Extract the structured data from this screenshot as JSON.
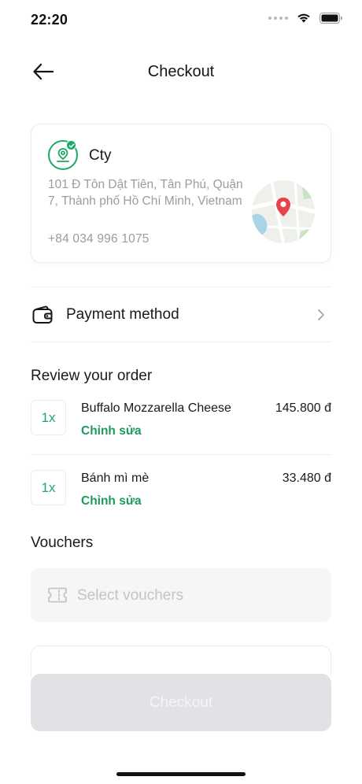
{
  "status_bar": {
    "time": "22:20"
  },
  "header": {
    "title": "Checkout",
    "back_icon": "arrow-left-icon"
  },
  "address": {
    "name": "Cty",
    "lines": "101 Đ Tôn Dật Tiên, Tân Phú, Quận 7, Thành phố Hồ Chí Minh, Vietnam",
    "phone": "+84 034 996 1075",
    "icon": "location-pin-icon",
    "accent_color": "#1ea866"
  },
  "payment": {
    "label": "Payment method",
    "icon": "wallet-icon"
  },
  "review": {
    "title": "Review your order",
    "items": [
      {
        "qty": "1x",
        "name": "Buffalo Mozzarella Cheese",
        "edit_label": "Chỉnh sửa",
        "price": "145.800 đ"
      },
      {
        "qty": "1x",
        "name": "Bánh mì mè",
        "edit_label": "Chỉnh sửa",
        "price": "33.480 đ"
      }
    ]
  },
  "vouchers": {
    "title": "Vouchers",
    "placeholder": "Select vouchers",
    "icon": "ticket-icon"
  },
  "checkout_button": {
    "label": "Checkout"
  },
  "colors": {
    "accent": "#1e9a5c",
    "disabled_button": "#e2e2e6",
    "muted_text": "#9c9ca1"
  }
}
